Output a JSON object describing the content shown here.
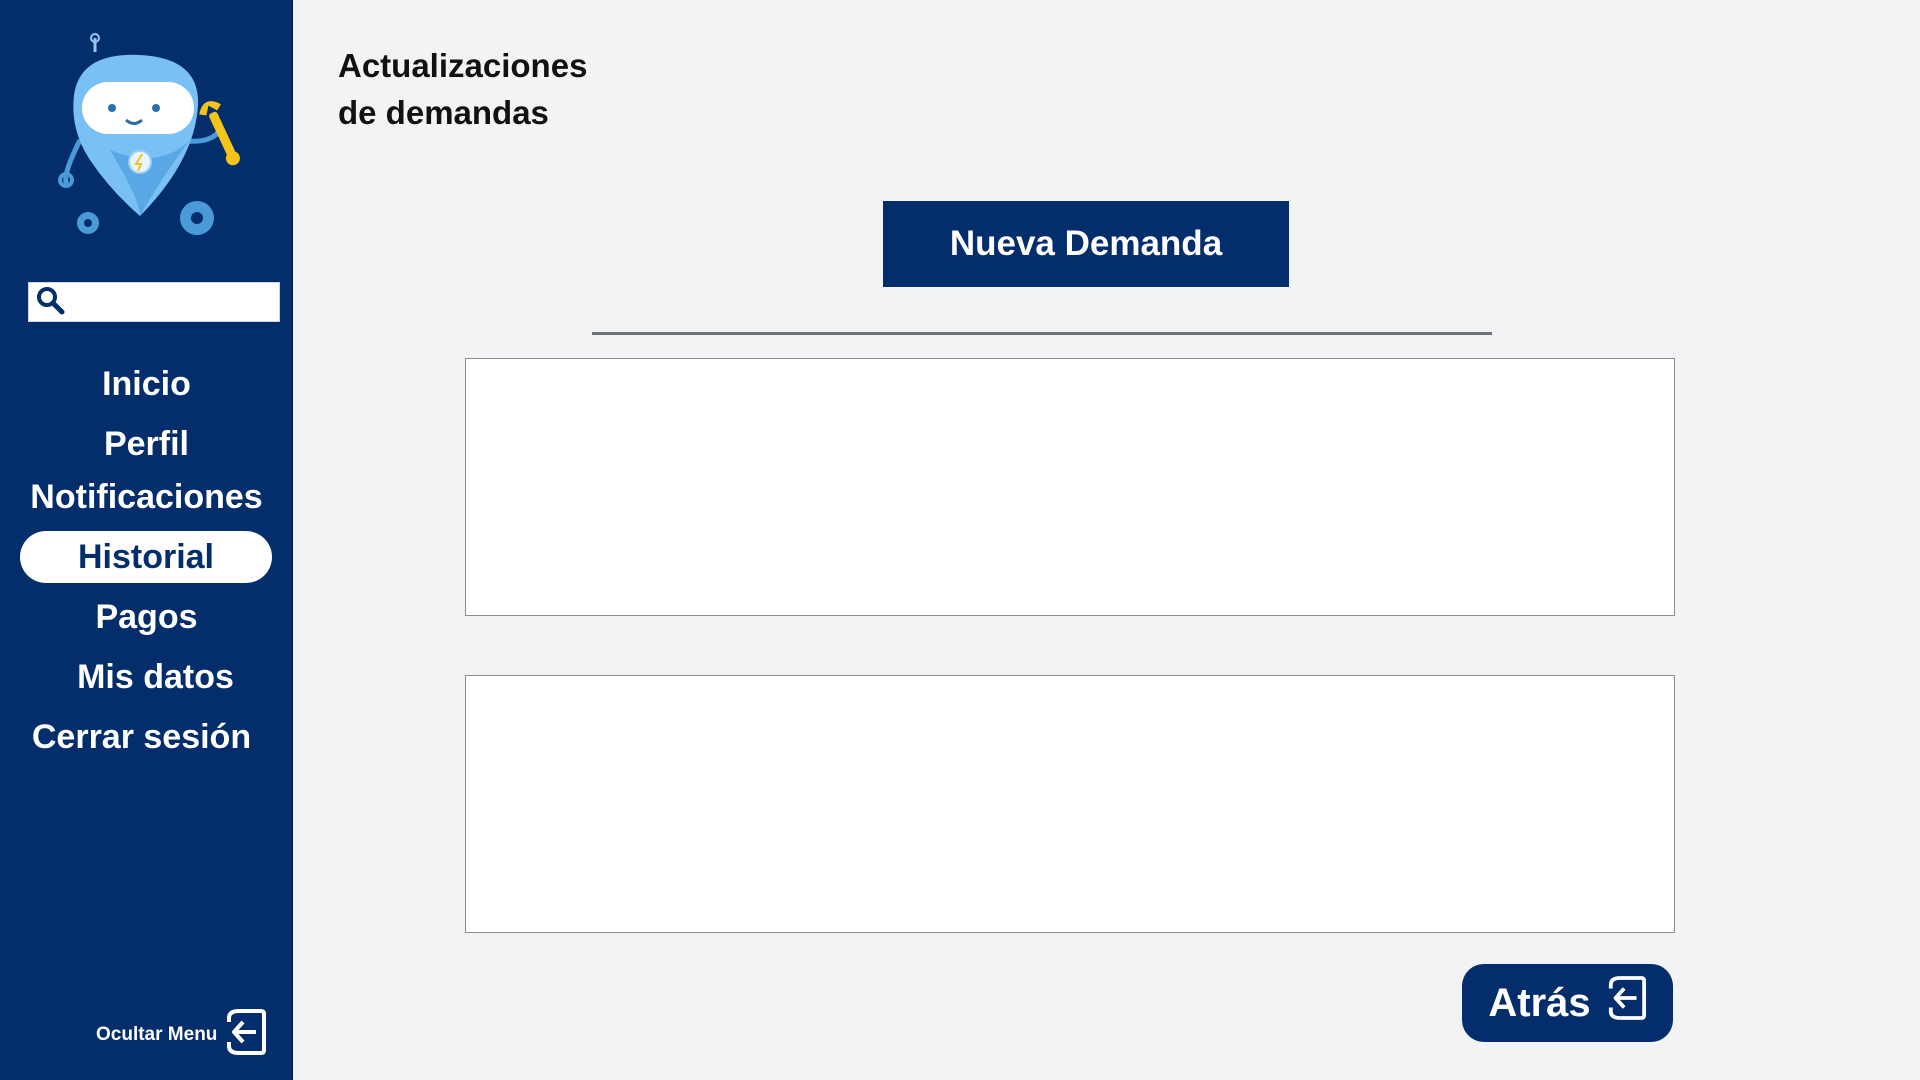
{
  "sidebar": {
    "search": {
      "placeholder": ""
    },
    "items": [
      {
        "label": "Inicio"
      },
      {
        "label": "Perfil"
      },
      {
        "label": "Notificaciones"
      },
      {
        "label": "Historial",
        "active": true
      },
      {
        "label": "Pagos"
      },
      {
        "label": "Mis datos"
      },
      {
        "label": "Cerrar sesión"
      }
    ],
    "hide_menu_label": "Ocultar Menu",
    "icons": {
      "logo": "robot-mascot-icon",
      "search": "search-icon",
      "hide_menu": "exit-arrow-icon"
    }
  },
  "main": {
    "title_line1": "Actualizaciones",
    "title_line2": "de demandas",
    "new_demand_label": "Nueva Demanda",
    "back_label": "Atrás",
    "back_icon": "exit-arrow-icon",
    "panels": [
      {},
      {}
    ]
  },
  "colors": {
    "brand": "#032e6b",
    "background": "#f2f3f5",
    "active_item_bg": "#ffffff",
    "mascot_blue": "#6fb9f3",
    "wrench_yellow": "#f5c419"
  }
}
